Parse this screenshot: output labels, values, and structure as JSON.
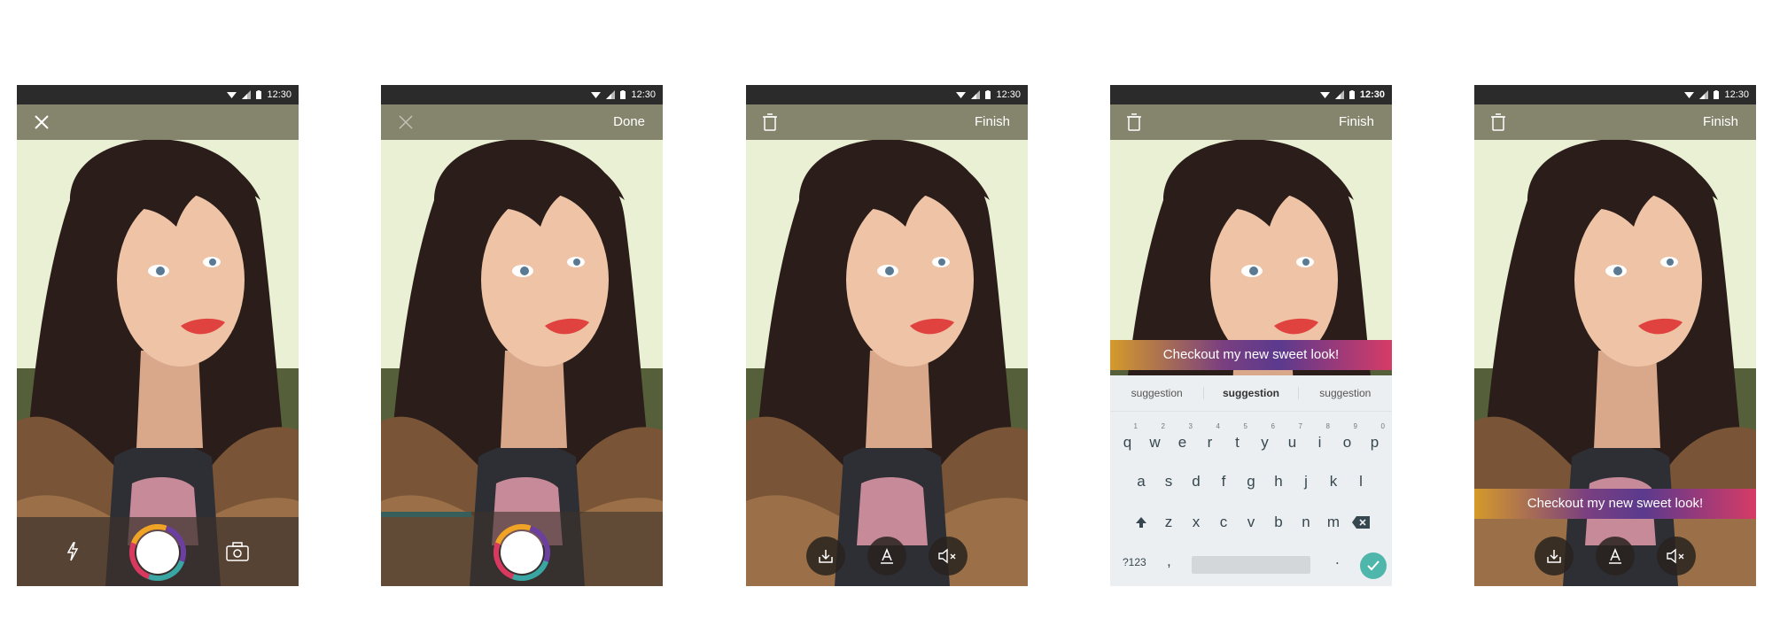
{
  "status_bar": {
    "time": "12:30"
  },
  "screens": [
    {
      "id": "camera",
      "appbar": {
        "left_icon": "close-icon",
        "right_label": ""
      }
    },
    {
      "id": "recording",
      "appbar": {
        "left_icon": "close-icon",
        "right_label": "Done"
      },
      "progress": 0.32
    },
    {
      "id": "review",
      "appbar": {
        "left_icon": "trash-icon",
        "right_label": "Finish"
      }
    },
    {
      "id": "caption-edit",
      "appbar": {
        "left_icon": "trash-icon",
        "right_label": "Finish"
      },
      "caption": "Checkout my new sweet look!"
    },
    {
      "id": "caption-review",
      "appbar": {
        "left_icon": "trash-icon",
        "right_label": "Finish"
      },
      "caption": "Checkout my new sweet look!"
    }
  ],
  "keyboard": {
    "suggestions": [
      "suggestion",
      "suggestion",
      "suggestion"
    ],
    "row1": [
      "q",
      "w",
      "e",
      "r",
      "t",
      "y",
      "u",
      "i",
      "o",
      "p"
    ],
    "row1_digits": [
      "1",
      "2",
      "3",
      "4",
      "5",
      "6",
      "7",
      "8",
      "9",
      "0"
    ],
    "row2": [
      "a",
      "s",
      "d",
      "f",
      "g",
      "h",
      "j",
      "k",
      "l"
    ],
    "row3": [
      "z",
      "x",
      "c",
      "v",
      "b",
      "n",
      "m"
    ],
    "symbols_key": "?123",
    "comma_key": ",",
    "period_key": "."
  },
  "colors": {
    "appbar": "#808068",
    "status_bar": "#2b2b2b",
    "progress": "#2fa3a6",
    "enter_key": "#4fb6ac",
    "caption_gradient": [
      "#d49a2a",
      "#7a3f80",
      "#d63b66"
    ]
  }
}
